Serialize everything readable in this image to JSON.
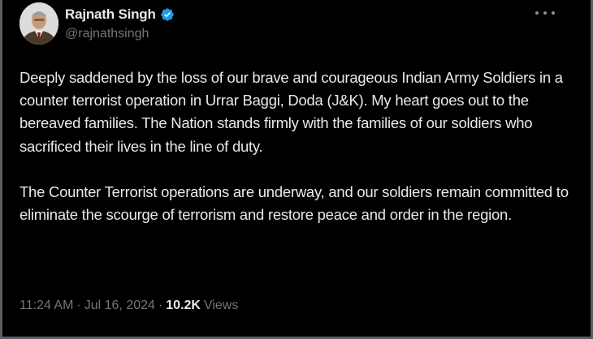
{
  "author": {
    "display_name": "Rajnath Singh",
    "handle": "@rajnathsingh",
    "verified": true,
    "avatar": "profile-photo"
  },
  "more_menu": {
    "icon": "more-horizontal-icon"
  },
  "tweet": {
    "paragraphs": [
      "Deeply saddened by the loss of our brave and courageous Indian Army Soldiers in a counter terrorist operation in Urrar Baggi, Doda (J&K). My heart goes out to the bereaved families. The Nation stands firmly with the families of our soldiers who sacrificed their lives in the line of duty.",
      "The Counter Terrorist operations are underway, and our soldiers remain committed to eliminate the scourge of terrorism and restore peace and order in the region."
    ]
  },
  "meta": {
    "time": "11:24 AM",
    "separator": "·",
    "date": "Jul 16, 2024",
    "views_count": "10.2K",
    "views_label": "Views"
  },
  "colors": {
    "background": "#000000",
    "text_primary": "#e7e9ea",
    "text_secondary": "#71767b",
    "verified_badge": "#1d9bf0"
  }
}
